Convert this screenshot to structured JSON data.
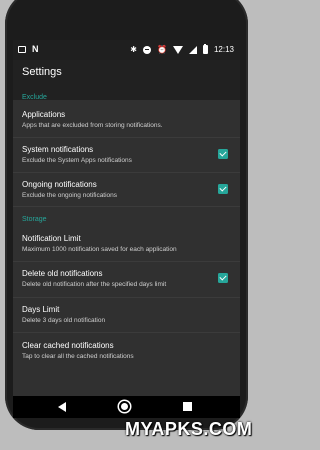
{
  "status_bar": {
    "time": "12:13",
    "icons": [
      "cast-icon",
      "n-logo-icon",
      "bluetooth-icon",
      "do-not-disturb-icon",
      "alarm-icon",
      "wifi-icon",
      "signal-icon",
      "battery-icon"
    ]
  },
  "toolbar": {
    "title": "Settings"
  },
  "sections": [
    {
      "header": "Exclude",
      "items": [
        {
          "title": "Applications",
          "summary": "Apps that are excluded from storing notifications.",
          "checked": null
        },
        {
          "title": "System notifications",
          "summary": "Exclude the System Apps notifications",
          "checked": true
        },
        {
          "title": "Ongoing notifications",
          "summary": "Exclude the ongoing notifications",
          "checked": true
        }
      ]
    },
    {
      "header": "Storage",
      "items": [
        {
          "title": "Notification Limit",
          "summary": "Maximum 1000 notification saved for each application",
          "checked": null
        },
        {
          "title": "Delete old notifications",
          "summary": "Delete old notification after the specified days limit",
          "checked": true
        },
        {
          "title": "Days Limit",
          "summary": "Delete 3 days old notification",
          "checked": null
        },
        {
          "title": "Clear cached notifications",
          "summary": "Tap to clear all the cached notifications",
          "checked": null
        }
      ]
    }
  ],
  "nav": {
    "icons": [
      "back-icon",
      "home-icon",
      "recents-icon"
    ]
  },
  "watermark": "MYAPKS.COM",
  "colors": {
    "accent": "#26a69a",
    "background": "#303030",
    "toolbar": "#212121"
  }
}
